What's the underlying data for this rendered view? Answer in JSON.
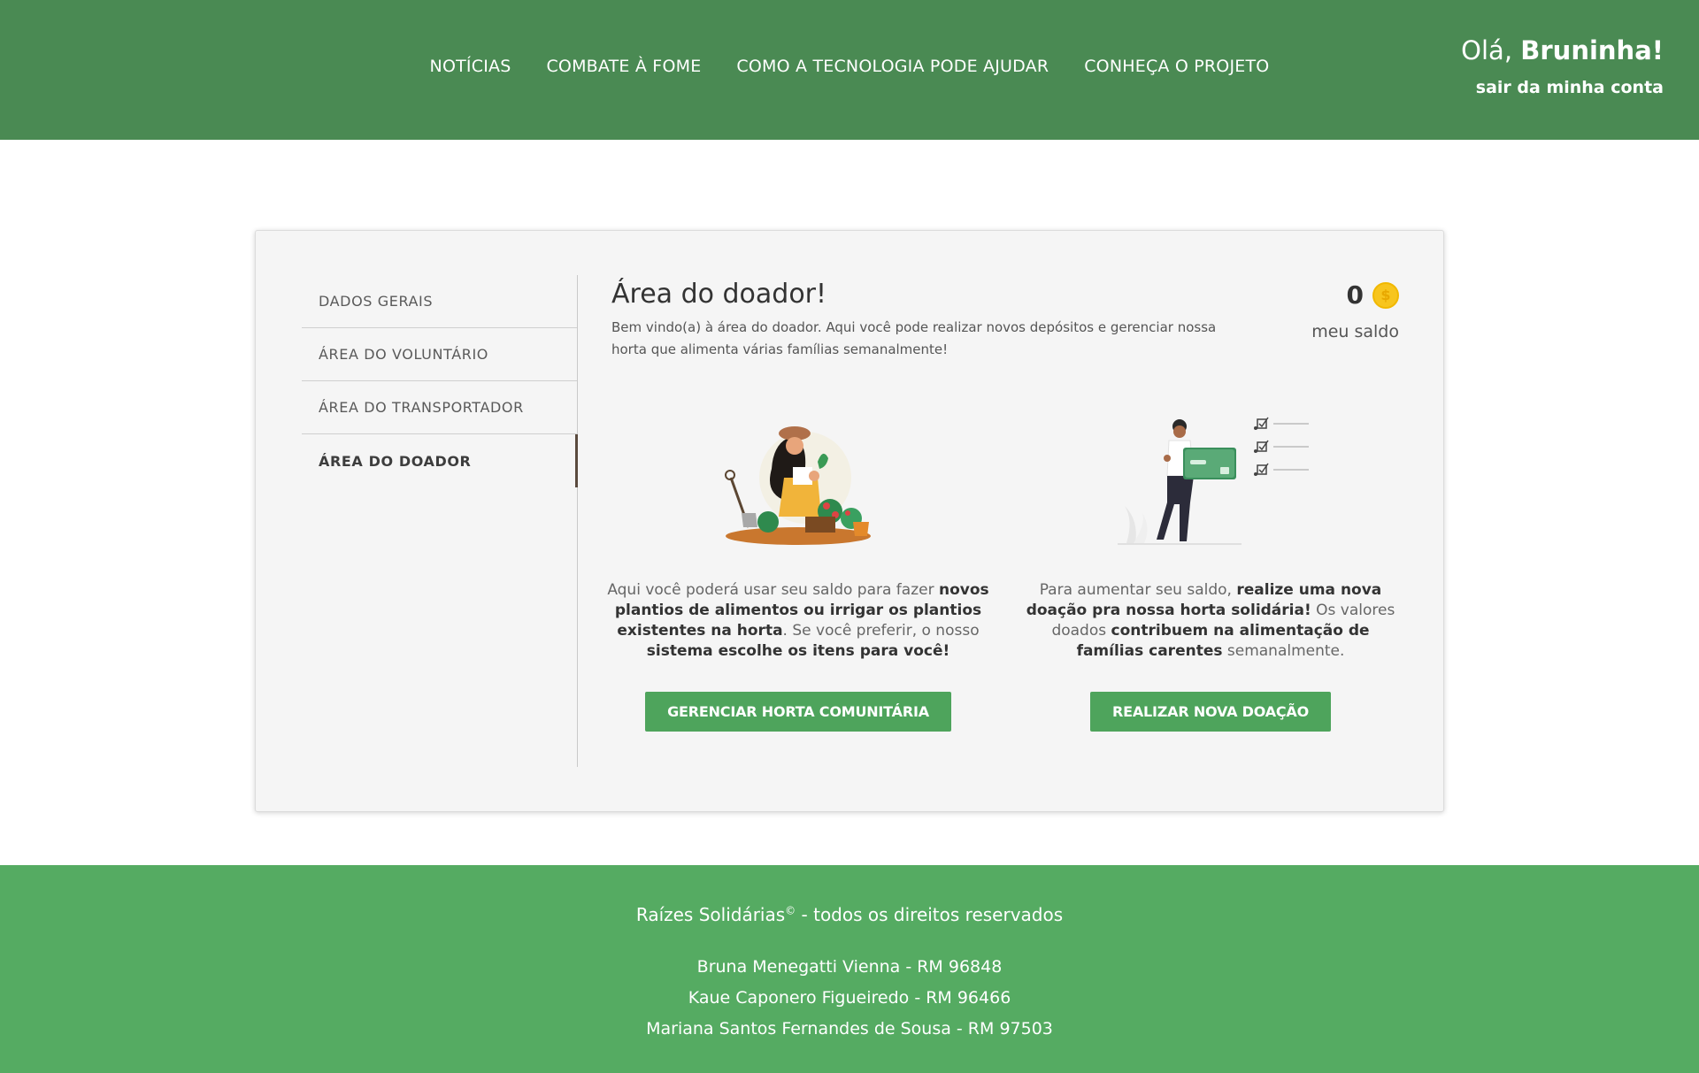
{
  "nav": {
    "items": [
      {
        "label": "NOTÍCIAS"
      },
      {
        "label": "COMBATE À FOME"
      },
      {
        "label": "COMO A TECNOLOGIA PODE AJUDAR"
      },
      {
        "label": "CONHEÇA O PROJETO"
      }
    ]
  },
  "user": {
    "greeting": "Olá,",
    "name": "Bruninha!",
    "logout": "sair da minha conta"
  },
  "sidebar": {
    "items": [
      {
        "label": "DADOS GERAIS",
        "active": false
      },
      {
        "label": "ÁREA DO VOLUNTÁRIO",
        "active": false
      },
      {
        "label": "ÁREA DO TRANSPORTADOR",
        "active": false
      },
      {
        "label": "ÁREA DO DOADOR",
        "active": true
      }
    ]
  },
  "main": {
    "title": "Área do doador!",
    "subtitle": "Bem vindo(a) à área do doador. Aqui você pode realizar novos depósitos e gerenciar nossa horta que alimenta várias famílias semanalmente!",
    "balance": {
      "value": "0",
      "coin_symbol": "$",
      "label": "meu saldo"
    },
    "left": {
      "icon": "gardener-illustration",
      "text": [
        {
          "t": "Aqui você poderá usar seu saldo para fazer ",
          "b": false
        },
        {
          "t": "novos plantios de alimentos ou irrigar os plantios existentes na horta",
          "b": true
        },
        {
          "t": ". Se você preferir, o nosso ",
          "b": false
        },
        {
          "t": "sistema escolhe os itens para você!",
          "b": true
        }
      ],
      "button": "GERENCIAR HORTA COMUNITÁRIA"
    },
    "right": {
      "icon": "donation-card-illustration",
      "text": [
        {
          "t": "Para aumentar seu saldo, ",
          "b": false
        },
        {
          "t": "realize uma nova doação pra nossa horta solidária!",
          "b": true
        },
        {
          "t": " Os valores doados ",
          "b": false
        },
        {
          "t": "contribuem na alimentação de famílias carentes",
          "b": true
        },
        {
          "t": " semanalmente.",
          "b": false
        }
      ],
      "button": "REALIZAR NOVA DOAÇÃO"
    }
  },
  "footer": {
    "brand": "Raízes Solidárias",
    "copyright_symbol": "©",
    "rights": " - todos os direitos reservados",
    "authors": [
      "Bruna Menegatti Vienna - RM 96848",
      "Kaue Caponero Figueiredo - RM 96466",
      "Mariana Santos Fernandes de Sousa - RM 97503"
    ]
  },
  "colors": {
    "header_bg": "#4a8a53",
    "footer_bg": "#55ab62",
    "button_bg": "#4ea45c",
    "coin": "#f7c51e"
  }
}
